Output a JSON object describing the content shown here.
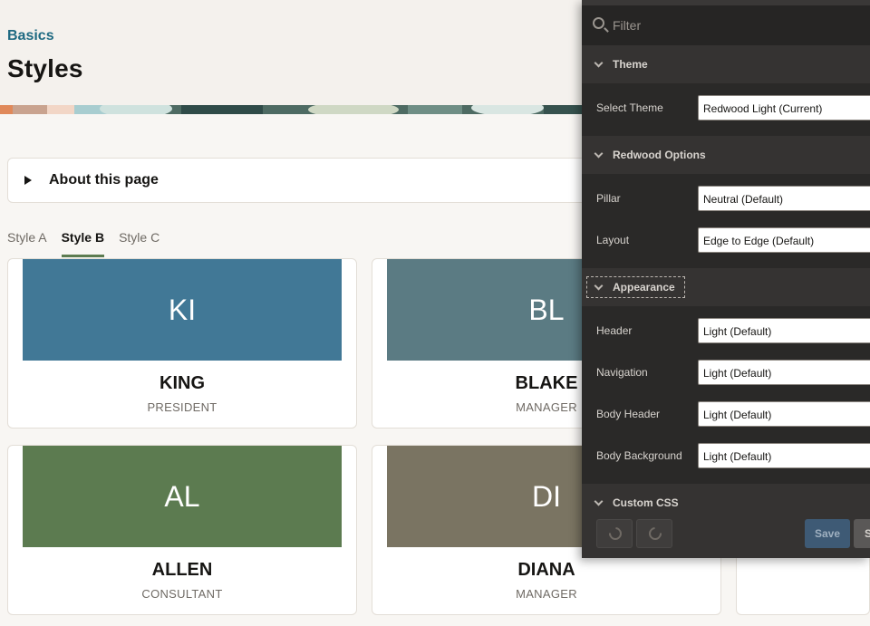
{
  "header": {
    "breadcrumb": "Basics",
    "title": "Styles"
  },
  "about": {
    "label": "About this page"
  },
  "tabs": [
    {
      "label": "Style A",
      "active": false
    },
    {
      "label": "Style B",
      "active": true
    },
    {
      "label": "Style C",
      "active": false
    }
  ],
  "cards": [
    {
      "initials": "KI",
      "name": "KING",
      "job": "PRESIDENT",
      "color": "#417896"
    },
    {
      "initials": "BL",
      "name": "BLAKE",
      "job": "MANAGER",
      "color": "#5b7b83"
    },
    {
      "initials": "AL",
      "name": "ALLEN",
      "job": "CONSULTANT",
      "color": "#5c7b50"
    },
    {
      "initials": "DI",
      "name": "DIANA",
      "job": "MANAGER",
      "color": "#7a7462"
    }
  ],
  "panel": {
    "filter_placeholder": "Filter",
    "sections": {
      "theme": {
        "title": "Theme",
        "select_theme_label": "Select Theme",
        "select_theme_value": "Redwood Light (Current)"
      },
      "redwood": {
        "title": "Redwood Options",
        "pillar_label": "Pillar",
        "pillar_value": "Neutral (Default)",
        "layout_label": "Layout",
        "layout_value": "Edge to Edge (Default)"
      },
      "appearance": {
        "title": "Appearance",
        "header_label": "Header",
        "header_value": "Light (Default)",
        "navigation_label": "Navigation",
        "navigation_value": "Light (Default)",
        "body_header_label": "Body Header",
        "body_header_value": "Light (Default)",
        "body_background_label": "Body Background",
        "body_background_value": "Light (Default)"
      },
      "custom_css": {
        "title": "Custom CSS"
      }
    },
    "footer": {
      "save_label": "Save",
      "save_as_label": "S"
    }
  },
  "icons": [
    "search-icon",
    "chevron-down-icon",
    "undo-icon",
    "redo-icon",
    "expand-triangle-icon"
  ]
}
